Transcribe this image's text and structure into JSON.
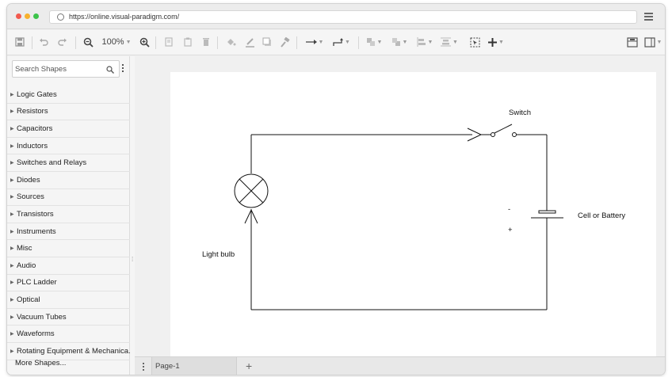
{
  "browser": {
    "url": "https://online.visual-paradigm.com/"
  },
  "toolbar": {
    "zoom": "100%"
  },
  "sidebar": {
    "search_placeholder": "Search Shapes",
    "categories": [
      "Logic Gates",
      "Resistors",
      "Capacitors",
      "Inductors",
      "Switches and Relays",
      "Diodes",
      "Sources",
      "Transistors",
      "Instruments",
      "Misc",
      "Audio",
      "PLC Ladder",
      "Optical",
      "Vacuum Tubes",
      "Waveforms",
      "Rotating Equipment & Mechanica..."
    ],
    "more_shapes": "More Shapes..."
  },
  "diagram": {
    "labels": {
      "switch": "Switch",
      "battery": "Cell or Battery",
      "bulb": "Light bulb",
      "minus": "-",
      "plus": "+"
    }
  },
  "pages": {
    "tabs": [
      "Page-1"
    ]
  },
  "icons": [
    "save-icon",
    "undo-icon",
    "redo-icon",
    "zoom-out-icon",
    "zoom-in-icon",
    "copy-icon",
    "paste-icon",
    "delete-icon",
    "fill-color-icon",
    "line-color-icon",
    "shadow-icon",
    "format-painter-icon",
    "connector-icon",
    "waypoint-icon",
    "to-front-icon",
    "to-back-icon",
    "align-icon",
    "distribute-icon",
    "select-icon",
    "add-icon",
    "panel-icon",
    "layout-icon",
    "hamburger-menu-icon",
    "search-icon"
  ]
}
